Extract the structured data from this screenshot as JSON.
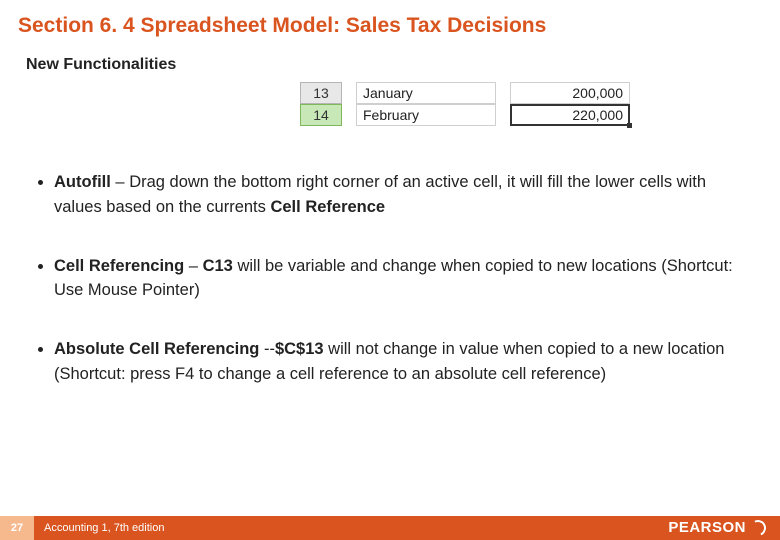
{
  "title": "Section 6. 4 Spreadsheet Model: Sales Tax Decisions",
  "subtitle": "New Functionalities",
  "sheet": {
    "row_headers": [
      "13",
      "14"
    ],
    "months": [
      "January",
      "February"
    ],
    "values": [
      "200,000",
      "220,000"
    ]
  },
  "bullets": [
    {
      "lead": "Autofill",
      "sep": " – ",
      "body_pre": "Drag down the bottom right corner of an active cell, it will fill the lower cells with values based on the currents ",
      "body_bold": "Cell Reference",
      "body_post": ""
    },
    {
      "lead": "Cell Referencing",
      "sep": " – ",
      "body_pre": "",
      "body_bold": "C13",
      "body_post": " will be variable and change when copied to new locations  (Shortcut: Use Mouse Pointer)"
    },
    {
      "lead": "Absolute Cell Referencing",
      "sep": " --",
      "body_pre": "",
      "body_bold": "$C$13",
      "body_post": " will not change in value when copied to a new location (Shortcut: press F4 to change a cell reference to an absolute cell reference)"
    }
  ],
  "footer": {
    "page": "27",
    "text": "Accounting 1, 7th edition"
  },
  "logo": {
    "text": "PEARSON"
  }
}
